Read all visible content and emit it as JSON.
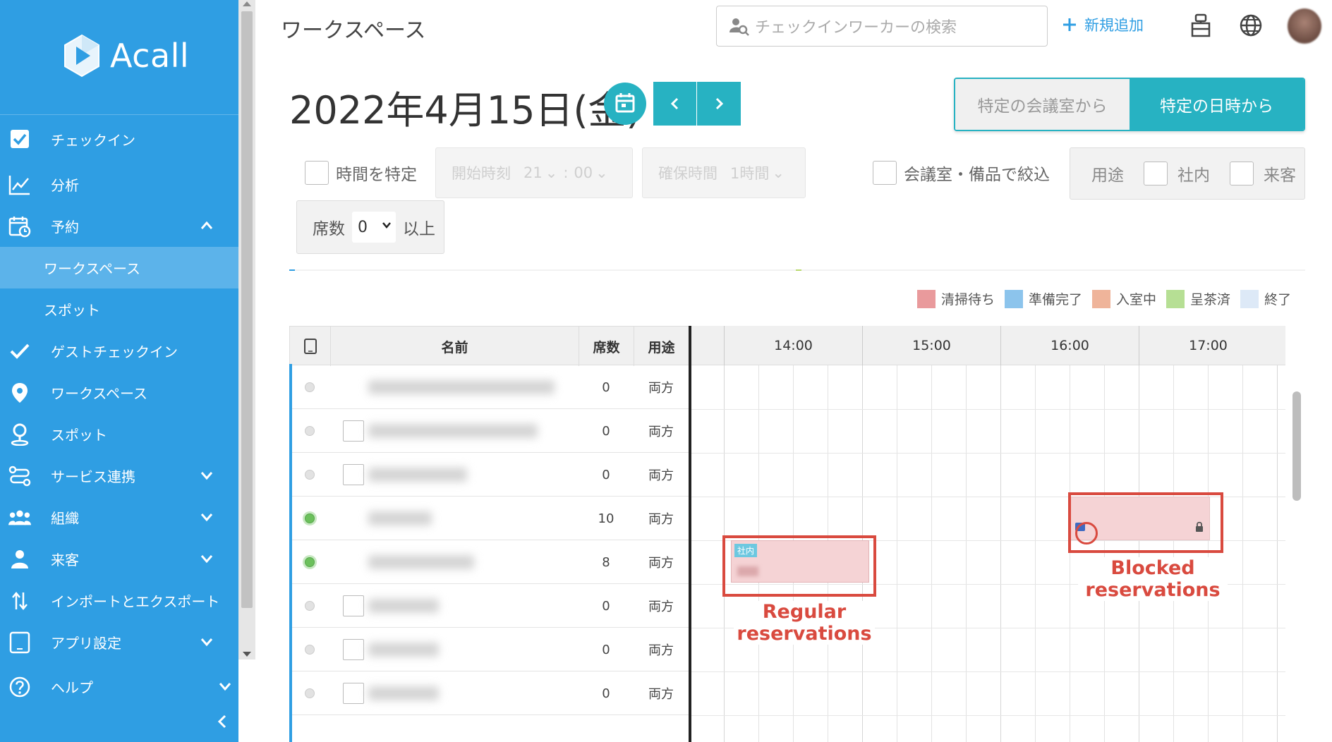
{
  "brand": {
    "name": "Acall"
  },
  "sidebar": {
    "items": [
      {
        "label": "チェックイン"
      },
      {
        "label": "分析"
      },
      {
        "label": "予約"
      },
      {
        "label": "ワークスペース"
      },
      {
        "label": "スポット"
      },
      {
        "label": "ゲストチェックイン"
      },
      {
        "label": "ワークスペース"
      },
      {
        "label": "スポット"
      },
      {
        "label": "サービス連携"
      },
      {
        "label": "組織"
      },
      {
        "label": "来客"
      },
      {
        "label": "インポートとエクスポート"
      },
      {
        "label": "アプリ設定"
      },
      {
        "label": "ヘルプ"
      }
    ]
  },
  "header": {
    "title": "ワークスペース",
    "search_placeholder": "チェックインワーカーの検索",
    "add_new": "新規追加"
  },
  "date_bar": {
    "date": "2022年4月15日(金)",
    "toggle": {
      "by_room": "特定の会議室から",
      "by_datetime": "特定の日時から"
    }
  },
  "filters": {
    "time_specify": "時間を特定",
    "start_time_label": "開始時刻",
    "start_hour": "21",
    "start_sep": ":",
    "start_min": "00",
    "duration_label": "確保時間",
    "duration_value": "1時間",
    "room_equipment": "会議室・備品で絞込",
    "purpose_label": "用途",
    "purpose_internal": "社内",
    "purpose_visitor": "来客",
    "seats_label": "席数",
    "seats_value": "0",
    "seats_suffix": "以上"
  },
  "legend": [
    {
      "label": "清掃待ち",
      "color": "#e99a9c"
    },
    {
      "label": "準備完了",
      "color": "#8cc4ec"
    },
    {
      "label": "入室中",
      "color": "#efb49a"
    },
    {
      "label": "呈茶済",
      "color": "#b6df94"
    },
    {
      "label": "終了",
      "color": "#dde9f7"
    }
  ],
  "table": {
    "headers": {
      "name": "名前",
      "seats": "席数",
      "purpose": "用途"
    },
    "hours": [
      "14:00",
      "15:00",
      "16:00",
      "17:00"
    ],
    "rows": [
      {
        "status": "grey",
        "checkbox": false,
        "seats": "0",
        "purpose": "両方"
      },
      {
        "status": "grey",
        "checkbox": true,
        "seats": "0",
        "purpose": "両方"
      },
      {
        "status": "grey",
        "checkbox": true,
        "seats": "0",
        "purpose": "両方"
      },
      {
        "status": "green",
        "checkbox": false,
        "seats": "10",
        "purpose": "両方"
      },
      {
        "status": "green",
        "checkbox": false,
        "seats": "8",
        "purpose": "両方"
      },
      {
        "status": "grey",
        "checkbox": true,
        "seats": "0",
        "purpose": "両方"
      },
      {
        "status": "grey",
        "checkbox": true,
        "seats": "0",
        "purpose": "両方"
      },
      {
        "status": "grey",
        "checkbox": true,
        "seats": "0",
        "purpose": "両方"
      }
    ]
  },
  "reservations": {
    "regular_tag": "社内"
  },
  "annotations": {
    "regular": "Regular reservations",
    "blocked": "Blocked reservations"
  }
}
